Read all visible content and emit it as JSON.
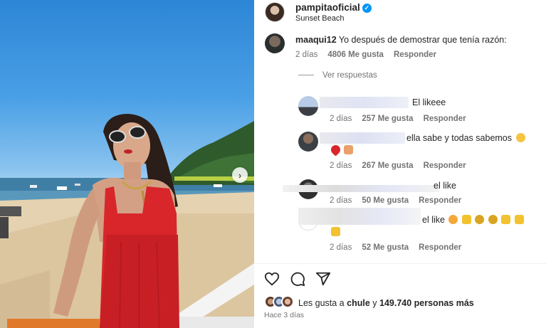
{
  "post": {
    "username": "pampitaoficial",
    "location": "Sunset Beach",
    "verified_glyph": "✓"
  },
  "comments": [
    {
      "user": "maaqui12",
      "text": "Yo después de demostrar que tenía razón:",
      "time": "2 días",
      "likes": "4806 Me gusta",
      "reply": "Responder"
    },
    {
      "user": "",
      "text": "El likeee",
      "time": "2 días",
      "likes": "257 Me gusta",
      "reply": "Responder"
    },
    {
      "user": "",
      "text": "ella sabe y todas sabemos",
      "time": "2 días",
      "likes": "267 Me gusta",
      "reply": "Responder"
    },
    {
      "user": "",
      "text": "el like",
      "time": "2 días",
      "likes": "50 Me gusta",
      "reply": "Responder"
    },
    {
      "user": "",
      "text": "el like",
      "time": "2 días",
      "likes": "52 Me gusta",
      "reply": "Responder"
    }
  ],
  "view_replies": "Ver respuestas",
  "footer": {
    "likes_prefix": "Les gusta a",
    "liker_name": "chule",
    "likes_mid": "y",
    "likes_count": "149.740 personas más",
    "time_ago": "Hace 3 días"
  },
  "icons": {
    "like": "heart-icon",
    "comment": "comment-icon",
    "share": "share-icon",
    "next": "chevron-right-icon"
  },
  "colors": {
    "verified": "#0095f6",
    "meta": "#737373",
    "dress": "#d8262b"
  }
}
